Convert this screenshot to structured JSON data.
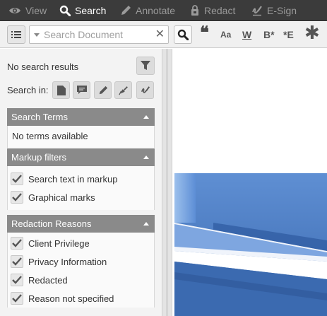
{
  "tabs": [
    {
      "label": "View",
      "icon": "eye-icon",
      "active": false
    },
    {
      "label": "Search",
      "icon": "search-icon",
      "active": true
    },
    {
      "label": "Annotate",
      "icon": "pen-icon",
      "active": false
    },
    {
      "label": "Redact",
      "icon": "redact-icon",
      "active": false
    },
    {
      "label": "E-Sign",
      "icon": "esign-icon",
      "active": false
    }
  ],
  "search": {
    "placeholder": "Search Document",
    "value": "",
    "clear_symbol": "✕",
    "options": [
      "❝",
      "Aa",
      "W",
      "B*",
      "*E",
      "✱"
    ]
  },
  "panel": {
    "status": "No search results",
    "search_in_label": "Search in:",
    "search_in_icons": [
      "document-icon",
      "comment-icon",
      "pen-icon",
      "redact-icon",
      "esign-icon"
    ]
  },
  "sections": {
    "terms": {
      "title": "Search Terms",
      "empty": "No terms available"
    },
    "markup": {
      "title": "Markup filters",
      "items": [
        {
          "label": "Search text in markup",
          "checked": true
        },
        {
          "label": "Graphical marks",
          "checked": true
        }
      ]
    },
    "reasons": {
      "title": "Redaction Reasons",
      "items": [
        {
          "label": "Client Privilege",
          "checked": true
        },
        {
          "label": "Privacy Information",
          "checked": true
        },
        {
          "label": "Redacted",
          "checked": true
        },
        {
          "label": "Reason not specified",
          "checked": true
        }
      ]
    }
  },
  "colors": {
    "toolbar_bg": "#3b3b3b",
    "section_header": "#8a8a8a",
    "doc_blue": "#3f6fb5"
  }
}
